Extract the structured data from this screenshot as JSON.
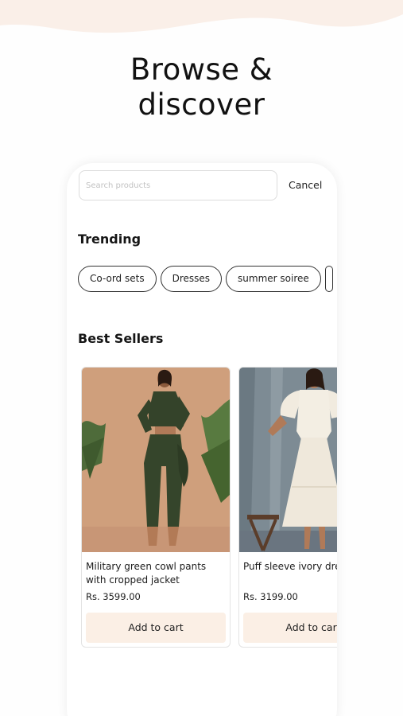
{
  "colors": {
    "wave": "#faefe8",
    "add_to_cart_bg": "#fbefe5",
    "chip_border": "#333333"
  },
  "headline": {
    "line1": "Browse &",
    "line2": "discover"
  },
  "search": {
    "placeholder": "Search products",
    "cancel_label": "Cancel"
  },
  "trending": {
    "title": "Trending",
    "chips": [
      "Co-ord sets",
      "Dresses",
      "summer soiree"
    ]
  },
  "best_sellers": {
    "title": "Best Sellers",
    "products": [
      {
        "name": "Military green cowl pants with cropped jacket",
        "price": "Rs. 3599.00",
        "button": "Add to cart"
      },
      {
        "name": "Puff sleeve ivory dress",
        "price": "Rs. 3199.00",
        "button": "Add to cart"
      }
    ]
  }
}
